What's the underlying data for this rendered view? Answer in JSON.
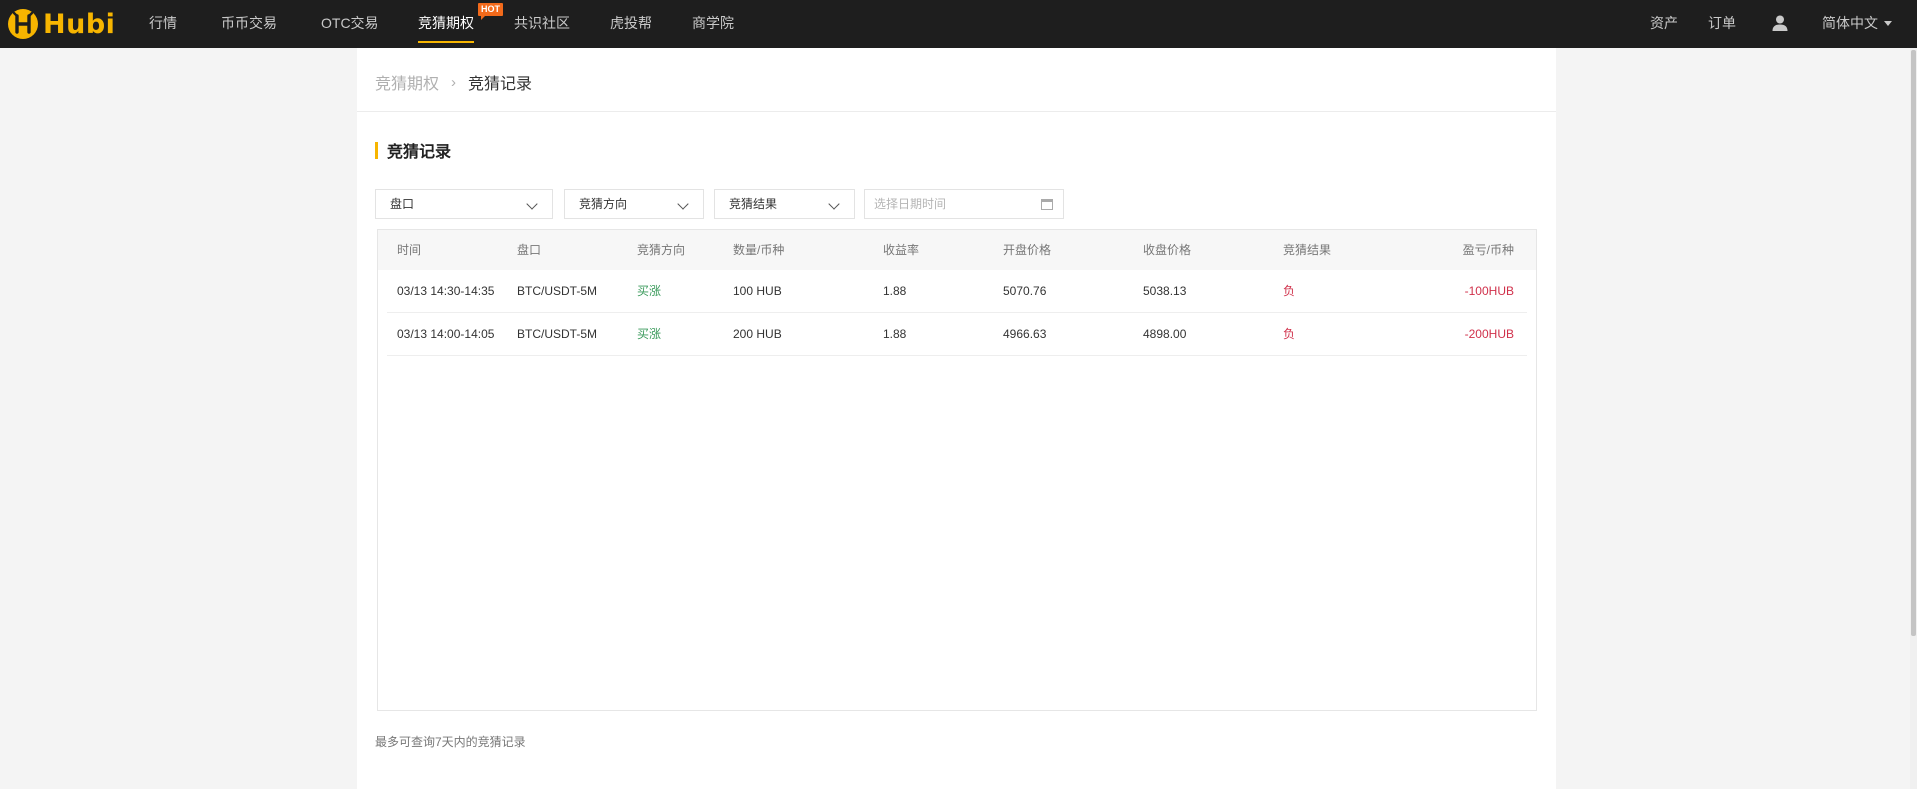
{
  "brand": {
    "logo_text": "Hubi",
    "accent": "#f7b500",
    "hot_color": "#f26a1b"
  },
  "nav": {
    "items": [
      {
        "label": "行情"
      },
      {
        "label": "币币交易"
      },
      {
        "label": "OTC交易"
      },
      {
        "label": "竞猜期权",
        "active": true,
        "badge": "HOT"
      },
      {
        "label": "共识社区"
      },
      {
        "label": "虎投帮"
      },
      {
        "label": "商学院"
      }
    ],
    "right": {
      "assets": "资产",
      "orders": "订单",
      "user_icon": "user-icon",
      "language": "简体中文"
    }
  },
  "breadcrumb": {
    "parent": "竞猜期权",
    "separator": "›",
    "current": "竞猜记录"
  },
  "section": {
    "title": "竞猜记录"
  },
  "filters": {
    "market": "盘口",
    "direction": "竞猜方向",
    "result": "竞猜结果",
    "date_placeholder": "选择日期时间"
  },
  "table": {
    "columns": [
      "时间",
      "盘口",
      "竞猜方向",
      "数量/币种",
      "收益率",
      "开盘价格",
      "收盘价格",
      "竞猜结果",
      "盈亏/币种"
    ],
    "rows": [
      [
        "03/13 14:30-14:35",
        "BTC/USDT-5M",
        "买涨",
        "100 HUB",
        "1.88",
        "5070.76",
        "5038.13",
        "负",
        "-100HUB"
      ],
      [
        "03/13 14:00-14:05",
        "BTC/USDT-5M",
        "买涨",
        "200 HUB",
        "1.88",
        "4966.63",
        "4898.00",
        "负",
        "-200HUB"
      ]
    ],
    "colors": {
      "up": "#3a9a5b",
      "loss": "#d0314b"
    }
  },
  "note": "最多可查询7天内的竞猜记录"
}
